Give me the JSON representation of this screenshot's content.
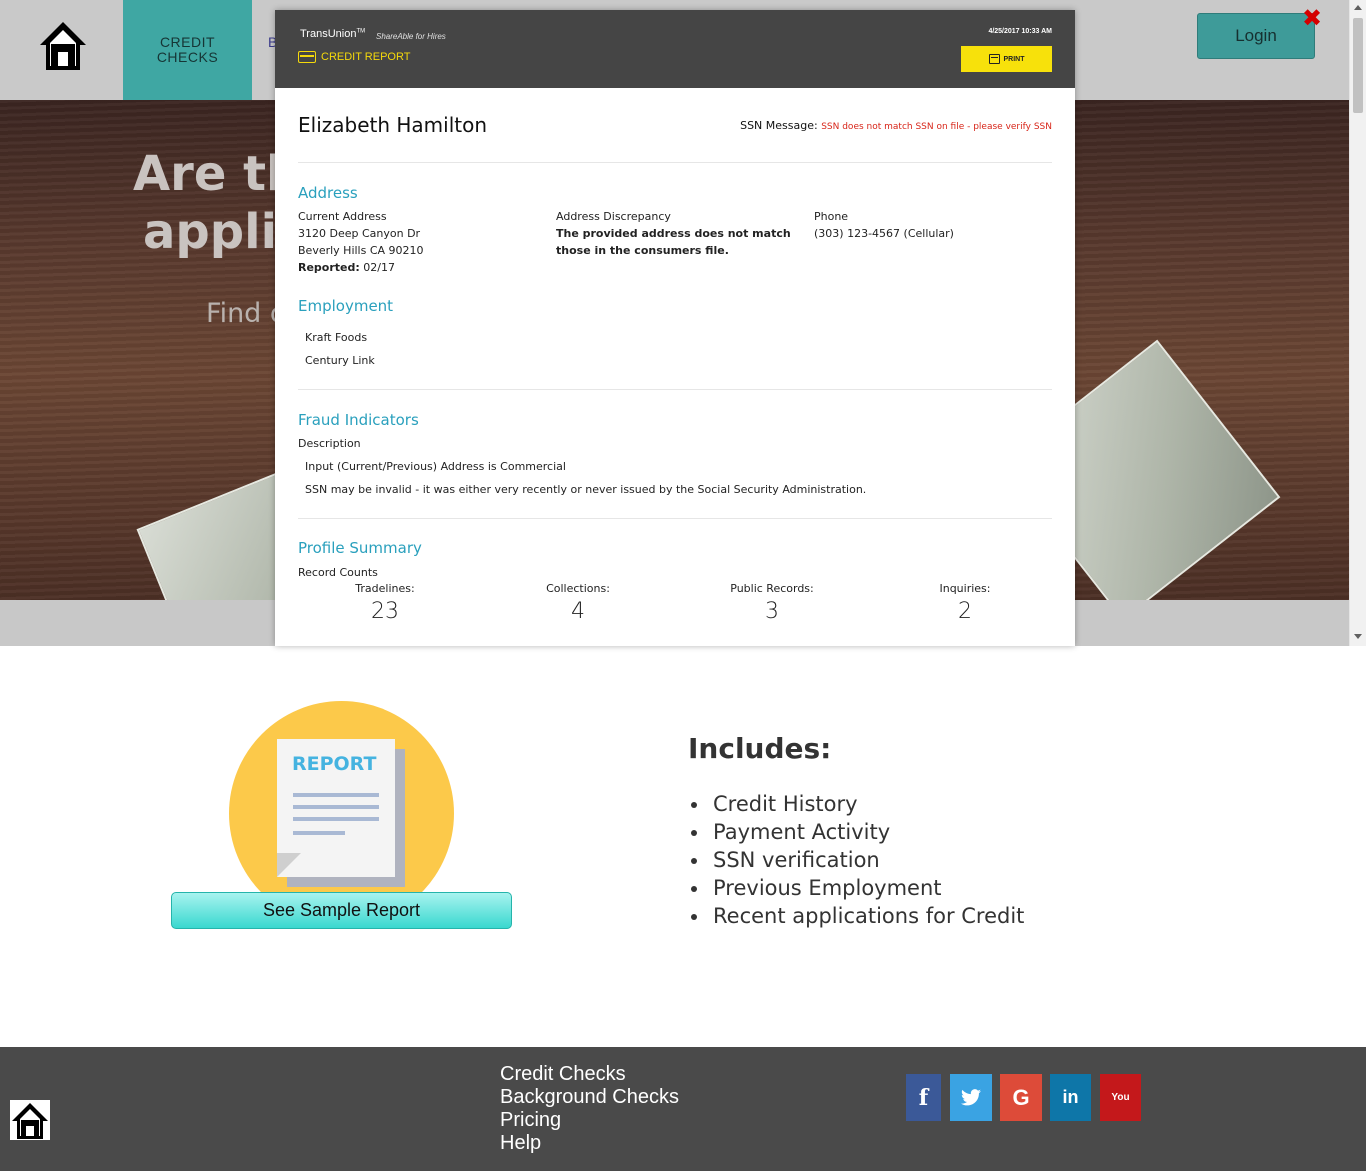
{
  "nav": {
    "credit_checks": "CREDIT CHECKS",
    "background_partial": "B",
    "login": "Login",
    "close": "✖"
  },
  "hero": {
    "title_line1": "Are th",
    "title_line2": "applic",
    "subtitle": "Find c"
  },
  "modal": {
    "brand": "TransUnion",
    "brand_tm": "TM",
    "shareable": "ShareAble for Hires",
    "credit_report_label": "CREDIT REPORT",
    "datetime": "4/25/2017 10:33 AM",
    "print_label": "PRINT",
    "customer_name": "Elizabeth Hamilton",
    "ssn_label": "SSN Message:",
    "ssn_message": "SSN does not match SSN on file - please verify SSN",
    "address": {
      "title": "Address",
      "current_label": "Current Address",
      "street": "3120 Deep Canyon Dr",
      "city": "Beverly Hills CA 90210",
      "reported_label": "Reported:",
      "reported_value": "02/17",
      "discrepancy_label": "Address Discrepancy",
      "discrepancy_text_line1": "The provided address does not match",
      "discrepancy_text_line2": "those in the consumers file.",
      "phone_label": "Phone",
      "phone_value": "(303) 123-4567 (Cellular)"
    },
    "employment": {
      "title": "Employment",
      "employers": [
        "Kraft Foods",
        "Century Link"
      ]
    },
    "fraud": {
      "title": "Fraud Indicators",
      "description_label": "Description",
      "items": [
        "Input (Current/Previous) Address is Commercial",
        "SSN may be invalid - it was either very recently or never issued by the Social Security Administration."
      ]
    },
    "profile": {
      "title": "Profile Summary",
      "record_counts_label": "Record Counts",
      "counts": [
        {
          "label": "Tradelines:",
          "value": "23"
        },
        {
          "label": "Collections:",
          "value": "4"
        },
        {
          "label": "Public Records:",
          "value": "3"
        },
        {
          "label": "Inquiries:",
          "value": "2"
        }
      ]
    }
  },
  "sample": {
    "report_word": "REPORT",
    "button": "See Sample Report"
  },
  "includes": {
    "title": "Includes:",
    "items": [
      "Credit History",
      "Payment Activity",
      "SSN verification",
      "Previous Employment",
      "Recent applications for Credit"
    ]
  },
  "footer": {
    "links": [
      "Credit Checks",
      "Background Checks",
      "Pricing",
      "Help"
    ],
    "social": [
      {
        "name": "facebook",
        "glyph": "f",
        "color": "#3b5998"
      },
      {
        "name": "twitter",
        "glyph": "t",
        "color": "#3aa3e3"
      },
      {
        "name": "google-plus",
        "glyph": "G",
        "color": "#dd4b39"
      },
      {
        "name": "linkedin",
        "glyph": "in",
        "color": "#0e76a8"
      },
      {
        "name": "youtube",
        "glyph": "You",
        "color": "#c4181b"
      }
    ]
  }
}
